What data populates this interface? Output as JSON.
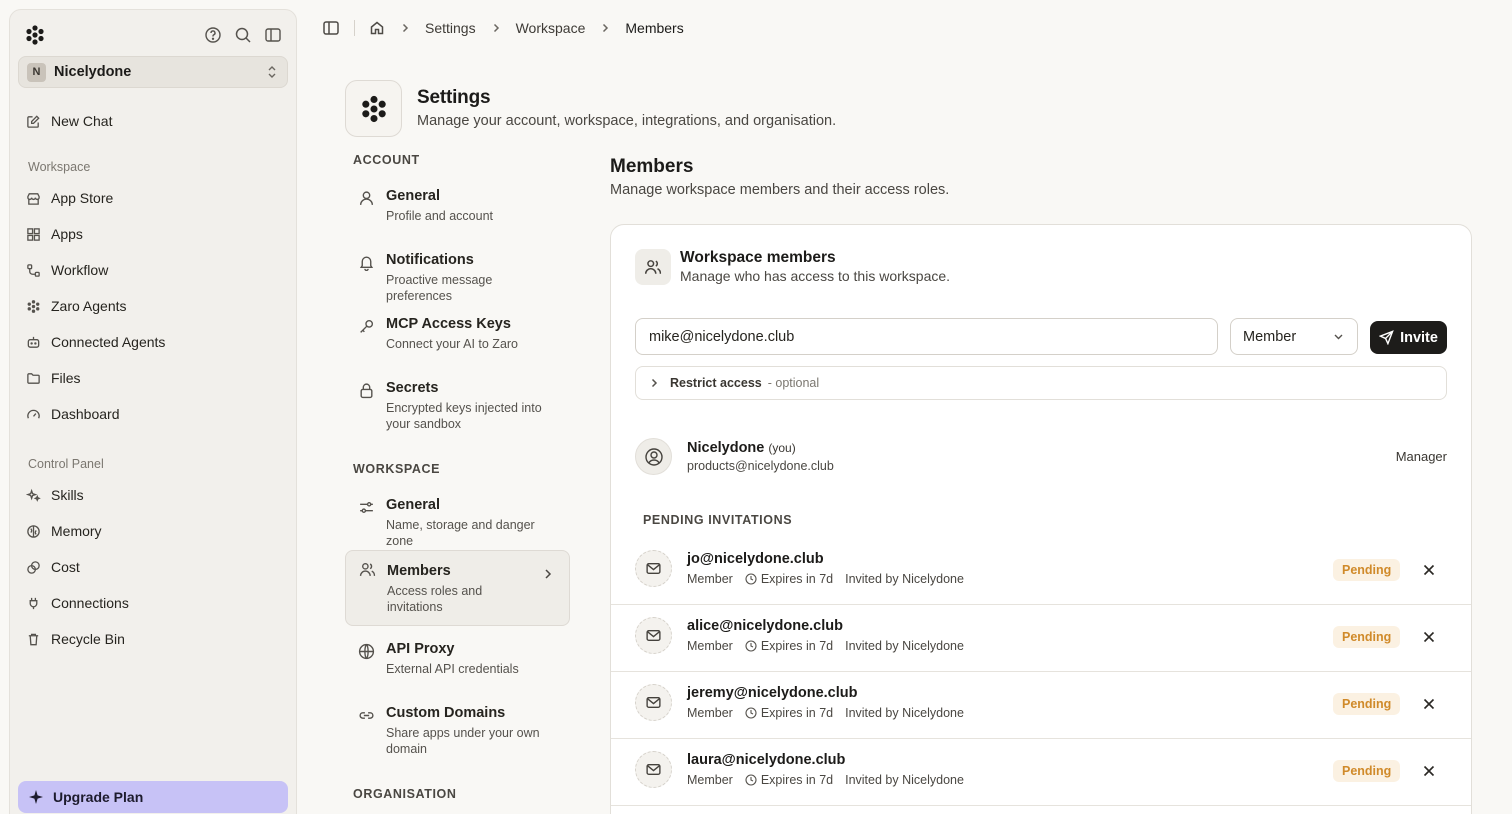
{
  "sidebar": {
    "workspace_initial": "N",
    "workspace_name": "Nicelydone",
    "new_chat": "New Chat",
    "workspace_section": "Workspace",
    "workspace_items": [
      "App Store",
      "Apps",
      "Workflow",
      "Zaro Agents",
      "Connected Agents",
      "Files",
      "Dashboard"
    ],
    "control_section": "Control Panel",
    "control_items": [
      "Skills",
      "Memory",
      "Cost",
      "Connections",
      "Recycle Bin"
    ],
    "upgrade": "Upgrade Plan"
  },
  "breadcrumb": {
    "items": [
      "Settings",
      "Workspace",
      "Members"
    ]
  },
  "settings": {
    "title": "Settings",
    "subtitle": "Manage your account, workspace, integrations, and organisation.",
    "account_section": "ACCOUNT",
    "workspace_section": "WORKSPACE",
    "organisation_section": "ORGANISATION",
    "nav": [
      {
        "title": "General",
        "desc": "Profile and account"
      },
      {
        "title": "Notifications",
        "desc": "Proactive message preferences"
      },
      {
        "title": "MCP Access Keys",
        "desc": "Connect your AI to Zaro"
      },
      {
        "title": "Secrets",
        "desc": "Encrypted keys injected into your sandbox"
      },
      {
        "title": "General",
        "desc": "Name, storage and danger zone"
      },
      {
        "title": "Members",
        "desc": "Access roles and invitations"
      },
      {
        "title": "API Proxy",
        "desc": "External API credentials"
      },
      {
        "title": "Custom Domains",
        "desc": "Share apps under your own domain"
      }
    ]
  },
  "members": {
    "title": "Members",
    "subtitle": "Manage workspace members and their access roles.",
    "card_title": "Workspace members",
    "card_subtitle": "Manage who has access to this workspace.",
    "email_value": "mike@nicelydone.club",
    "role_value": "Member",
    "invite_label": "Invite",
    "restrict_label": "Restrict access",
    "restrict_optional": "- optional",
    "current_member": {
      "name": "Nicelydone",
      "you": "(you)",
      "email": "products@nicelydone.club",
      "role": "Manager"
    },
    "pending_title": "PENDING INVITATIONS",
    "invitations": [
      {
        "email": "jo@nicelydone.club",
        "role": "Member",
        "expires": "Expires in 7d",
        "invited_by": "Invited by Nicelydone",
        "status": "Pending"
      },
      {
        "email": "alice@nicelydone.club",
        "role": "Member",
        "expires": "Expires in 7d",
        "invited_by": "Invited by Nicelydone",
        "status": "Pending"
      },
      {
        "email": "jeremy@nicelydone.club",
        "role": "Member",
        "expires": "Expires in 7d",
        "invited_by": "Invited by Nicelydone",
        "status": "Pending"
      },
      {
        "email": "laura@nicelydone.club",
        "role": "Member",
        "expires": "Expires in 7d",
        "invited_by": "Invited by Nicelydone",
        "status": "Pending"
      }
    ]
  },
  "colors": {
    "accent_upgrade": "#c7c2f6",
    "pending_text": "#d08a2a",
    "pending_bg": "#fbf1e2",
    "invite_bg": "#1d1c1a"
  }
}
